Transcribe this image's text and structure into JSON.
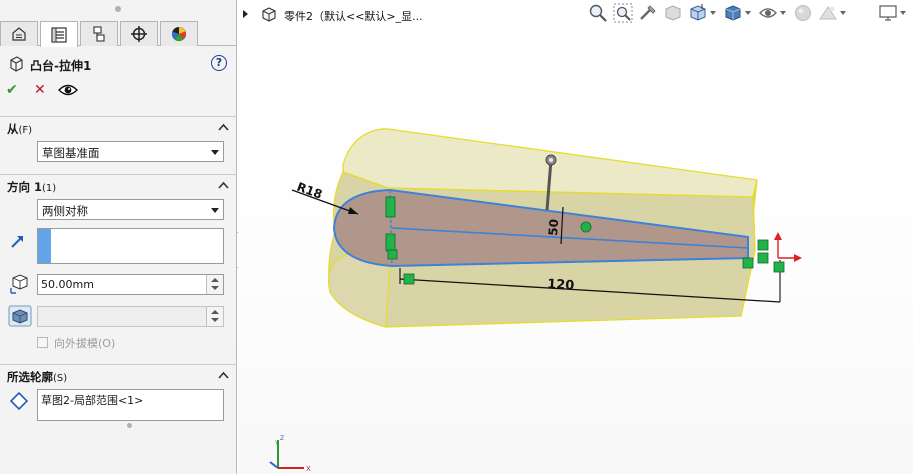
{
  "panel": {
    "feature_title": "凸台-拉伸1",
    "help_label": "?",
    "ok_label": "✔",
    "cancel_label": "✕",
    "tabs": [
      "feature-manager-icon",
      "property-manager-icon",
      "configuration-manager-icon",
      "dimxpert-icon",
      "display-manager-icon"
    ],
    "from": {
      "title": "从",
      "hint": "(F)",
      "value": "草图基准面"
    },
    "direction1": {
      "title": "方向 1",
      "hint": "(1)",
      "end_condition": "两侧对称",
      "depth": "50.00mm"
    },
    "draft_outward_label": "向外拔模(O)",
    "selected_contours": {
      "title": "所选轮廓",
      "hint": "(S)",
      "value": "草图2-局部范围<1>"
    }
  },
  "viewport": {
    "breadcrumb": "零件2（默认<<默认>_显...",
    "dimensions": {
      "radius": "R18",
      "length": "120",
      "height": "50"
    },
    "triad_labels": {
      "x": "X",
      "y": "Y",
      "z": "Z"
    },
    "toolbar_icons": [
      "zoom-to-fit-icon",
      "zoom-to-area-icon",
      "previous-view-icon",
      "section-view-icon",
      "view-orientation-icon",
      "display-style-icon",
      "hide-show-items-icon",
      "edit-appearance-icon",
      "apply-scene-icon",
      "view-settings-icon"
    ]
  },
  "colors": {
    "body_fill": "#d9d4a6",
    "edge_yellow": "#e6dc2a",
    "sketch_blue": "#3d82d8",
    "relation_green": "#22b24a",
    "dim_black": "#111111",
    "accent_blue": "#63a4ea"
  }
}
